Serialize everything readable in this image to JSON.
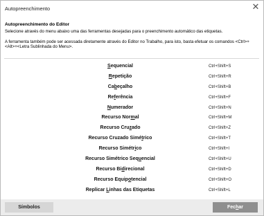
{
  "window": {
    "title": "Autopreenchimento",
    "close_glyph": "✕"
  },
  "content": {
    "heading": "Autopreenchimento do Editor",
    "description": "Selecione através do menu abaixo uma das ferramentas desejadas para o preenchimento automático das etiquetas.",
    "note": "A ferramenta também pode ser acessada diretamente através do Editor no Trabalho, para isto, basta efetuar os comandos <Ctrl>+<Alt>+<Letra Sublinhada do Menu>."
  },
  "commands": [
    {
      "before": "",
      "u": "S",
      "after": "equencial",
      "shortcut": "Ctrl+Shift+S"
    },
    {
      "before": "",
      "u": "R",
      "after": "epetição",
      "shortcut": "Ctrl+Shift+R"
    },
    {
      "before": "Ca",
      "u": "b",
      "after": "eçalho",
      "shortcut": "Ctrl+Shift+B"
    },
    {
      "before": "Re",
      "u": "f",
      "after": "erência",
      "shortcut": "Ctrl+Shift+F"
    },
    {
      "before": "",
      "u": "N",
      "after": "umerador",
      "shortcut": "Ctrl+Shift+N"
    },
    {
      "before": "Recurso Nor",
      "u": "m",
      "after": "al",
      "shortcut": "Ctrl+Shift+M"
    },
    {
      "before": "Recurso Cru",
      "u": "z",
      "after": "ado",
      "shortcut": "Ctrl+Shift+Z"
    },
    {
      "before": "Recurso Cruzado Simé",
      "u": "t",
      "after": "rico",
      "shortcut": "Ctrl+Shift+T"
    },
    {
      "before": "Recurso Simétr",
      "u": "i",
      "after": "co",
      "shortcut": "Ctrl+Shift+I"
    },
    {
      "before": "Recurso Simétrico Seq",
      "u": "u",
      "after": "encial",
      "shortcut": "Ctrl+Shift+U"
    },
    {
      "before": "Recurso Bi",
      "u": "d",
      "after": "irecional",
      "shortcut": "Ctrl+Shift+D"
    },
    {
      "before": "Recurso Equip",
      "u": "o",
      "after": "tencial",
      "shortcut": "Ctrl+Shift+O"
    },
    {
      "before": "Replicar ",
      "u": "L",
      "after": "inhas das Etiquetas",
      "shortcut": "Ctrl+Shift+L"
    }
  ],
  "footer": {
    "symbols_label": "Símbolos",
    "close_before": "Fec",
    "close_u": "h",
    "close_after": "ar"
  }
}
